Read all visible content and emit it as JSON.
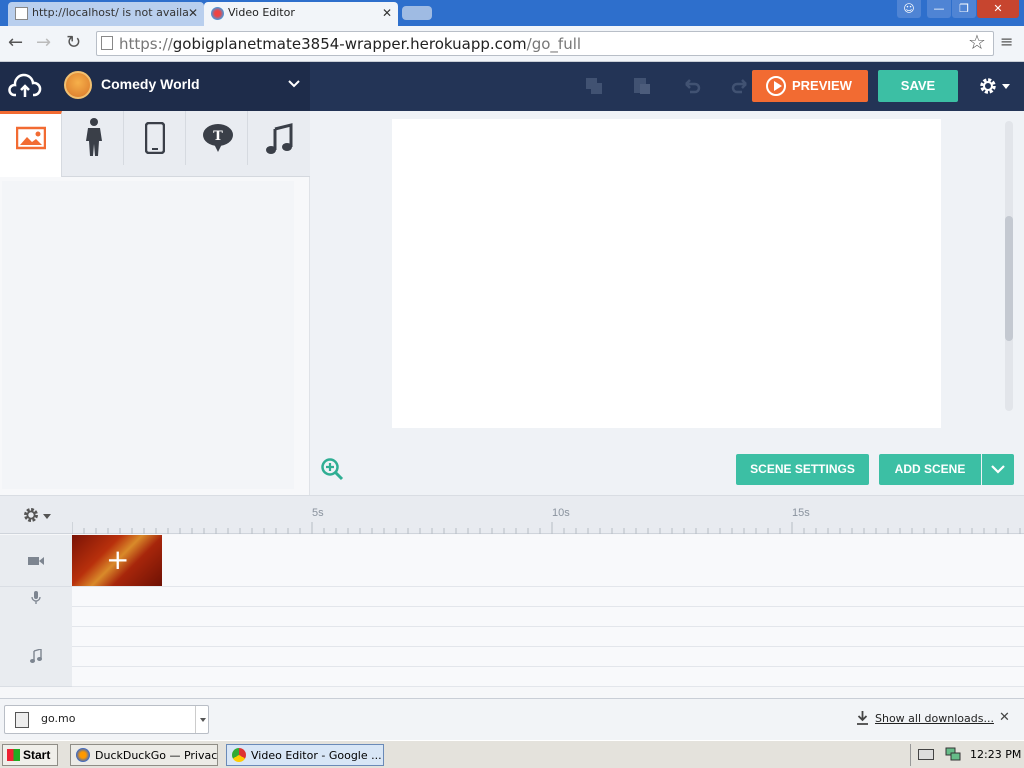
{
  "browser": {
    "tabs": [
      {
        "label": "http://localhost/ is not availa",
        "active": false
      },
      {
        "label": "Video Editor",
        "active": true
      }
    ],
    "url_scheme": "https://",
    "url_host": "gobigplanetmate3854-wrapper.herokuapp.com",
    "url_path": "/go_full"
  },
  "header": {
    "project_title": "Comedy World",
    "preview_label": "PREVIEW",
    "save_label": "SAVE"
  },
  "asset_tabs": [
    {
      "icon": "image-icon",
      "active": true
    },
    {
      "icon": "character-icon",
      "active": false
    },
    {
      "icon": "prop-phone-icon",
      "active": false
    },
    {
      "icon": "text-bubble-icon",
      "active": false
    },
    {
      "icon": "music-note-icon",
      "active": false
    }
  ],
  "stage": {
    "scene_settings_label": "SCENE SETTINGS",
    "add_scene_label": "ADD SCENE"
  },
  "timeline": {
    "ticks": [
      "5s",
      "10s",
      "15s"
    ],
    "tracks": [
      "video-camera-icon",
      "microphone-icon",
      "music-note-icon"
    ]
  },
  "downloads": {
    "file_name": "go.mo",
    "show_all_label": "Show all downloads..."
  },
  "taskbar": {
    "start_label": "Start",
    "tasks": [
      {
        "label": "DuckDuckGo — Privac..."
      },
      {
        "label": "Video Editor - Google ..."
      }
    ],
    "clock": "12:23 PM"
  },
  "colors": {
    "header_bg": "#233456",
    "accent_orange": "#f26b32",
    "accent_teal": "#3cbfa4"
  }
}
